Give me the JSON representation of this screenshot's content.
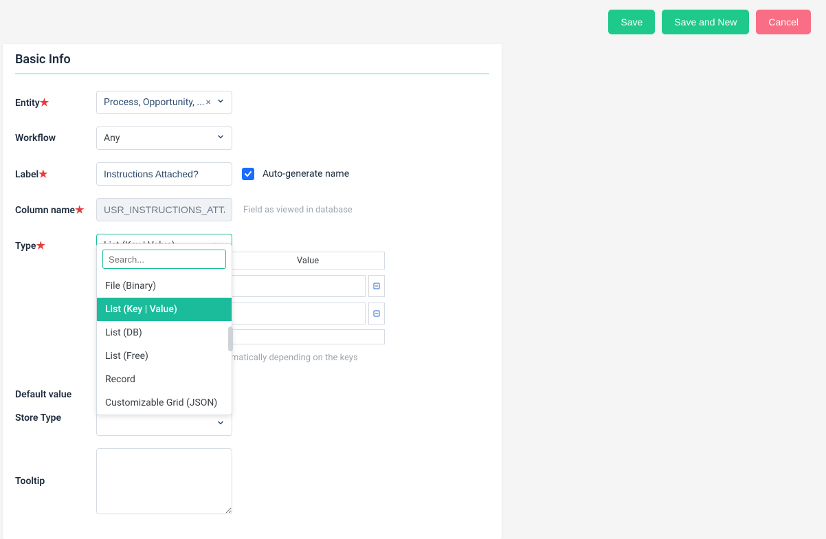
{
  "actions": {
    "save": "Save",
    "save_and_new": "Save and New",
    "cancel": "Cancel"
  },
  "panel": {
    "title": "Basic Info"
  },
  "form": {
    "entity": {
      "label": "Entity",
      "value": "Process, Opportunity, ..."
    },
    "workflow": {
      "label": "Workflow",
      "value": "Any"
    },
    "label_field": {
      "label": "Label",
      "value": "Instructions Attached?"
    },
    "auto_generate": {
      "label": "Auto-generate name",
      "checked": true
    },
    "column_name": {
      "label": "Column name",
      "value": "USR_INSTRUCTIONS_ATTAC",
      "helper": "Field as viewed in database"
    },
    "type": {
      "label": "Type",
      "value": "List (Key | Value)"
    },
    "default_value": {
      "label": "Default value"
    },
    "store_type": {
      "label": "Store Type"
    },
    "tooltip": {
      "label": "Tooltip"
    }
  },
  "type_dropdown": {
    "search_placeholder": "Search...",
    "options": [
      "File (Binary)",
      "List (Key | Value)",
      "List (DB)",
      "List (Free)",
      "Record",
      "Customizable Grid (JSON)"
    ],
    "selected_index": 1
  },
  "kv_table": {
    "header_value": "Value",
    "keys_hint": "matically depending on the keys"
  }
}
